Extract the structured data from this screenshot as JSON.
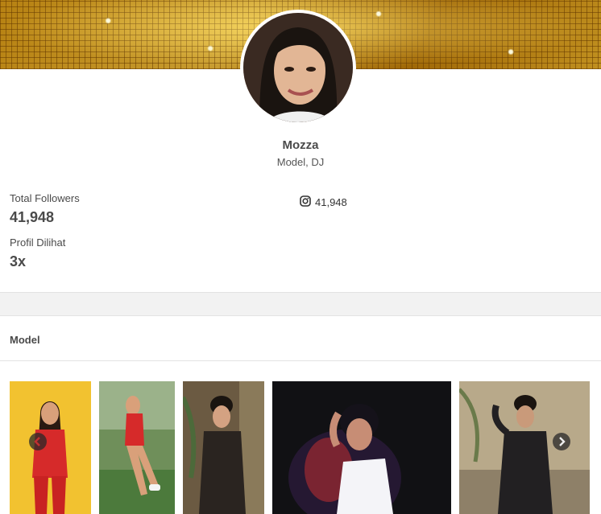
{
  "profile": {
    "name": "Mozza",
    "role": "Model, DJ"
  },
  "stats": {
    "followers_label": "Total Followers",
    "followers_value": "41,948",
    "views_label": "Profil Dilihat",
    "views_value": "3x"
  },
  "social": {
    "instagram_icon": "instagram-icon",
    "instagram_count": "41,948"
  },
  "section": {
    "title": "Model"
  },
  "gallery": {
    "prev_icon": "arrow-left-icon",
    "next_icon": "arrow-right-icon",
    "photos": 5
  },
  "colors": {
    "banner_gold": "#d9a21c",
    "divider": "#e3e3e3",
    "band": "#f2f2f2"
  }
}
